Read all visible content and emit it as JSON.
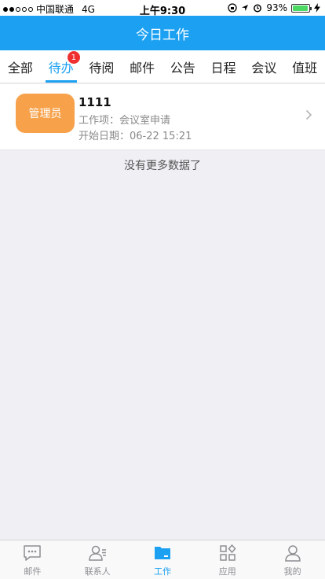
{
  "status": {
    "carrier": "中国联通",
    "network": "4G",
    "time": "上午9:30",
    "battery": "93%",
    "battery_level": 0.93,
    "signal_dots_filled": 2,
    "signal_dots_total": 5
  },
  "header": {
    "title": "今日工作"
  },
  "tabs": [
    {
      "label": "全部"
    },
    {
      "label": "待办",
      "badge": "1"
    },
    {
      "label": "待阅"
    },
    {
      "label": "邮件"
    },
    {
      "label": "公告"
    },
    {
      "label": "日程"
    },
    {
      "label": "会议"
    },
    {
      "label": "值班"
    }
  ],
  "list": {
    "items": [
      {
        "avatar_text": "管理员",
        "title": "1111",
        "work_item": "工作项：会议室申请",
        "start_date": "开始日期：06-22 15:21"
      }
    ],
    "no_more": "没有更多数据了"
  },
  "tabbar": {
    "items": [
      {
        "label": "邮件",
        "icon": "message-icon"
      },
      {
        "label": "联系人",
        "icon": "contacts-icon"
      },
      {
        "label": "工作",
        "icon": "folder-icon"
      },
      {
        "label": "应用",
        "icon": "apps-icon"
      },
      {
        "label": "我的",
        "icon": "person-icon"
      }
    ]
  },
  "colors": {
    "brand": "#1ca1f2",
    "avatar": "#f7a24b",
    "badge": "#f03030"
  }
}
